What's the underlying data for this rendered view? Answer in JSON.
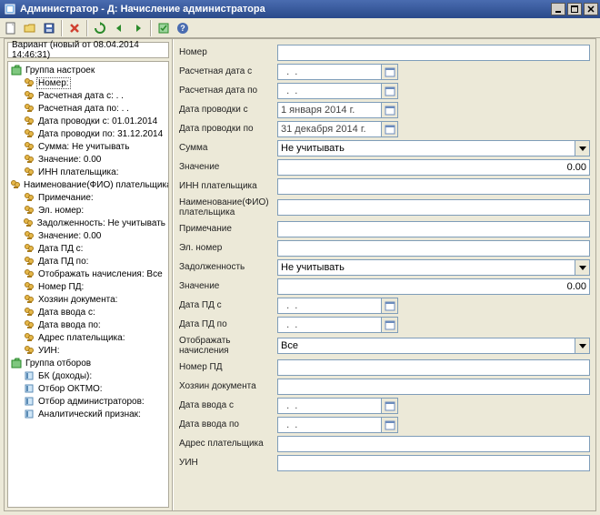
{
  "window": {
    "title": "Администратор - Д: Начисление администратора"
  },
  "variant": "Вариант (новый от 08.04.2014 14:46:31)",
  "tree": {
    "group_settings": "Группа настроек",
    "items_settings": [
      "Номер:",
      "Расчетная дата с:  .  .",
      "Расчетная дата по:  .  .",
      "Дата проводки с:  01.01.2014",
      "Дата проводки по:  31.12.2014",
      "Сумма:  Не учитывать",
      "Значение:  0.00",
      "ИНН плательщика:",
      "Наименование(ФИО) плательщика:",
      "Примечание:",
      "Эл. номер:",
      "Задолженность:  Не учитывать",
      "Значение:  0.00",
      "Дата ПД с:",
      "Дата ПД по:",
      "Отображать начисления:  Все",
      "Номер ПД:",
      "Хозяин документа:",
      "Дата ввода с:",
      "Дата ввода по:",
      "Адрес плательщика:",
      "УИН:"
    ],
    "group_filters": "Группа отборов",
    "items_filters": [
      "БК (доходы):",
      "Отбор ОКТМО:",
      "Отбор администраторов:",
      "Аналитический признак:"
    ]
  },
  "form": {
    "nomer_label": "Номер",
    "nomer_value": "",
    "raschet_s_label": "Расчетная дата с",
    "raschet_s_value": "  .  .",
    "raschet_po_label": "Расчетная дата по",
    "raschet_po_value": "  .  .",
    "provodka_s_label": "Дата проводки с",
    "provodka_s_value": "1 января 2014 г.",
    "provodka_po_label": "Дата проводки по",
    "provodka_po_value": "31 декабря 2014 г.",
    "summa_label": "Сумма",
    "summa_value": "Не учитывать",
    "znach1_label": "Значение",
    "znach1_value": "0.00",
    "inn_label": "ИНН плательщика",
    "inn_value": "",
    "fio_label": "Наименование(ФИО) плательщика",
    "fio_value": "",
    "prim_label": "Примечание",
    "prim_value": "",
    "enomer_label": "Эл. номер",
    "enomer_value": "",
    "zadol_label": "Задолженность",
    "zadol_value": "Не учитывать",
    "znach2_label": "Значение",
    "znach2_value": "0.00",
    "datapd_s_label": "Дата ПД с",
    "datapd_s_value": "  .  .",
    "datapd_po_label": "Дата ПД по",
    "datapd_po_value": "  .  .",
    "otobr_label": "Отображать начисления",
    "otobr_value": "Все",
    "nomerpd_label": "Номер ПД",
    "nomerpd_value": "",
    "hozyain_label": "Хозяин документа",
    "hozyain_value": "",
    "vvod_s_label": "Дата ввода с",
    "vvod_s_value": "  .  .",
    "vvod_po_label": "Дата ввода по",
    "vvod_po_value": "  .  .",
    "adres_label": "Адрес плательщика",
    "adres_value": "",
    "uin_label": "УИН",
    "uin_value": ""
  }
}
